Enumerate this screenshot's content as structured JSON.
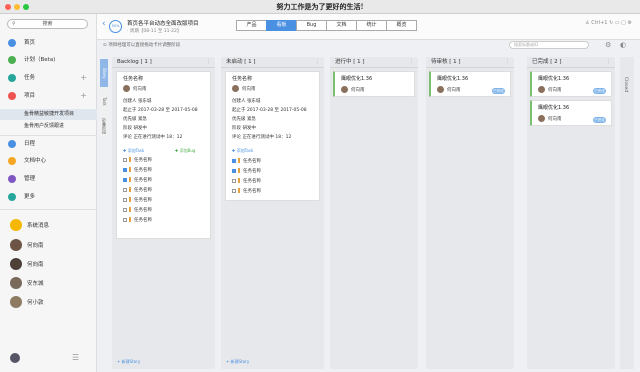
{
  "window": {
    "title": "努力工作是为了更好的生活!"
  },
  "sidebar": {
    "search_label": "搜索",
    "nav": [
      {
        "label": "首页",
        "color": "#4a90e2"
      },
      {
        "label": "计划（Beta)",
        "color": "#4caf50"
      },
      {
        "label": "任务",
        "color": "#26a69a"
      },
      {
        "label": "项目",
        "color": "#ef5350"
      }
    ],
    "projects": [
      "鱼骨精益敏捷开发项目",
      "鱼骨用户反馈跟进"
    ],
    "nav2": [
      {
        "label": "日程",
        "color": "#4a90e2"
      },
      {
        "label": "文档中心",
        "color": "#f5a623"
      },
      {
        "label": "管理",
        "color": "#7e57c2"
      },
      {
        "label": "更多",
        "color": "#26a69a"
      }
    ],
    "people": [
      "系统消息",
      "何向南",
      "何向南",
      "安东城",
      "何小敦"
    ]
  },
  "header": {
    "progress": "50%",
    "project_title": "首页各平台动态全面改版项目",
    "project_meta": "· 周期【08-11 至 11-22】",
    "tabs": [
      "产品",
      "看板",
      "Bug",
      "文档",
      "统计",
      "概览"
    ],
    "active_tab": "看板",
    "right_label": "Ctrl+1"
  },
  "toolbar": {
    "filter_text": "项目经理可以直接拖动卡片调整阶段",
    "search_placeholder": "搜索标题或ID"
  },
  "side_tabs": {
    "story": "Story",
    "task": "Task",
    "hide": "折叠阶段"
  },
  "board": {
    "columns": [
      {
        "title": "Backlog [ 1 ]"
      },
      {
        "title": "未启动 [ 1 ]"
      },
      {
        "title": "进行中 [ 1 ]"
      },
      {
        "title": "待审核 [ 1 ]"
      },
      {
        "title": "已完成 [ 2 ]"
      }
    ],
    "story_card": {
      "title": "任务名称",
      "user": "何向南",
      "creator_label": "创建人",
      "creator": "张东城",
      "dates_label": "起止于",
      "dates": "2017-03-28 至 2017-05-08",
      "priority_label": "优先级",
      "priority": "紧急",
      "stage_label": "阶段",
      "stage": "研发中",
      "review_label": "评论",
      "review": "正在进行测试中  18：12",
      "add_task": "添加Task",
      "add_bug": "添加Bug",
      "todos": [
        "任务名称",
        "任务名称",
        "任务名称",
        "任务名称",
        "任务名称",
        "任务名称",
        "任务名称"
      ]
    },
    "small_card": {
      "title": "鹰眼优化1.36",
      "user": "何向南",
      "badge": "已完成"
    },
    "new_story": "+ 新建Story"
  },
  "closed_label": "Closed"
}
